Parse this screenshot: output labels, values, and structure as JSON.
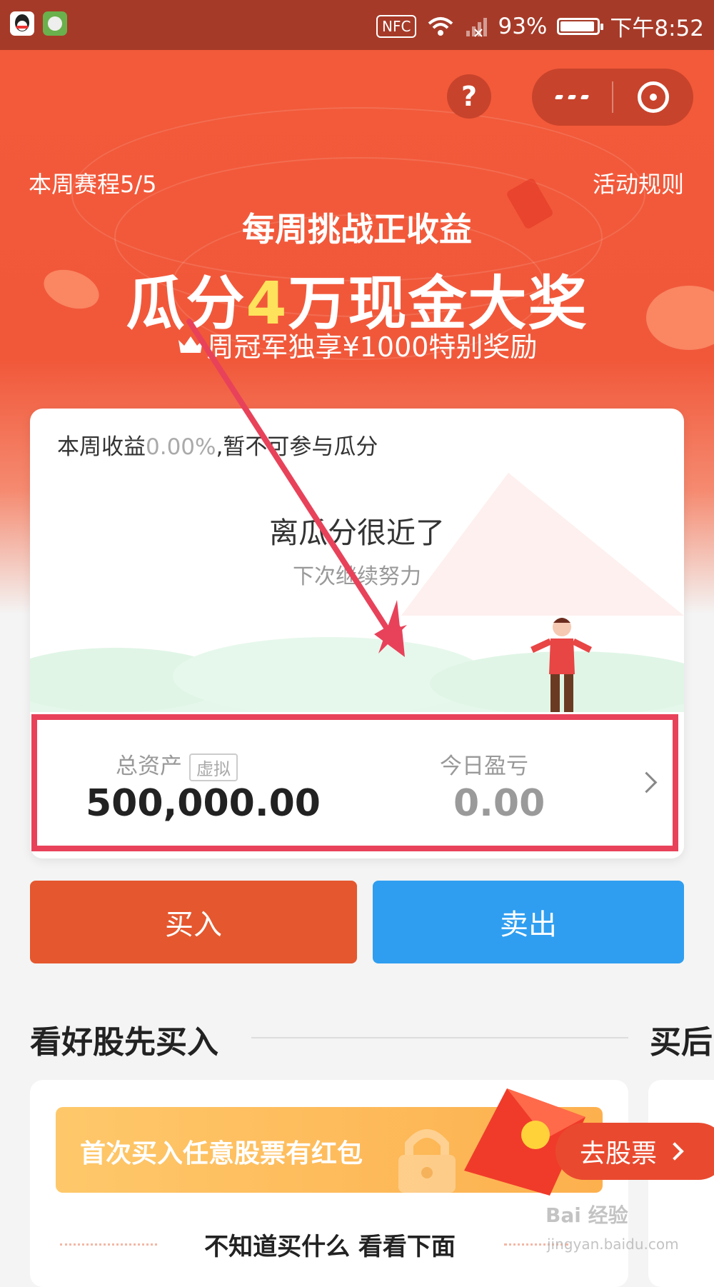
{
  "status_bar": {
    "nfc": "NFC",
    "battery_percent": "93%",
    "battery_level": 0.93,
    "time": "下午8:52"
  },
  "header": {
    "help_icon_text": "?",
    "week_progress": "本周赛程5/5",
    "rules_link": "活动规则"
  },
  "banner": {
    "line1": "每周挑战正收益",
    "line2_pre": "瓜分",
    "line2_num": "4",
    "line2_post": "万现金大奖",
    "line3": "周冠军独享¥1000特别奖励",
    "accent_color": "#ffe25b"
  },
  "card": {
    "weekly_return_prefix": "本周收益",
    "weekly_return_value": "0.00%",
    "weekly_return_suffix": ",暂不可参与瓜分",
    "status_title": "离瓜分很近了",
    "status_sub": "下次继续努力",
    "total_assets_label": "总资产",
    "virtual_tag": "虚拟",
    "total_assets_value": "500,000.00",
    "today_pl_label": "今日盈亏",
    "today_pl_value": "0.00"
  },
  "actions": {
    "buy": "买入",
    "sell": "卖出",
    "buy_color": "#e5572e",
    "sell_color": "#2f9ef0"
  },
  "section": {
    "title": "看好股先买入",
    "title2": "买后",
    "promo_text": "首次买入任意股票有红包",
    "go_button": "去股票",
    "unsure_text": "不知道买什么 看看下面"
  },
  "watermark": {
    "brand": "Bai 经验",
    "url": "jingyan.baidu.com"
  }
}
